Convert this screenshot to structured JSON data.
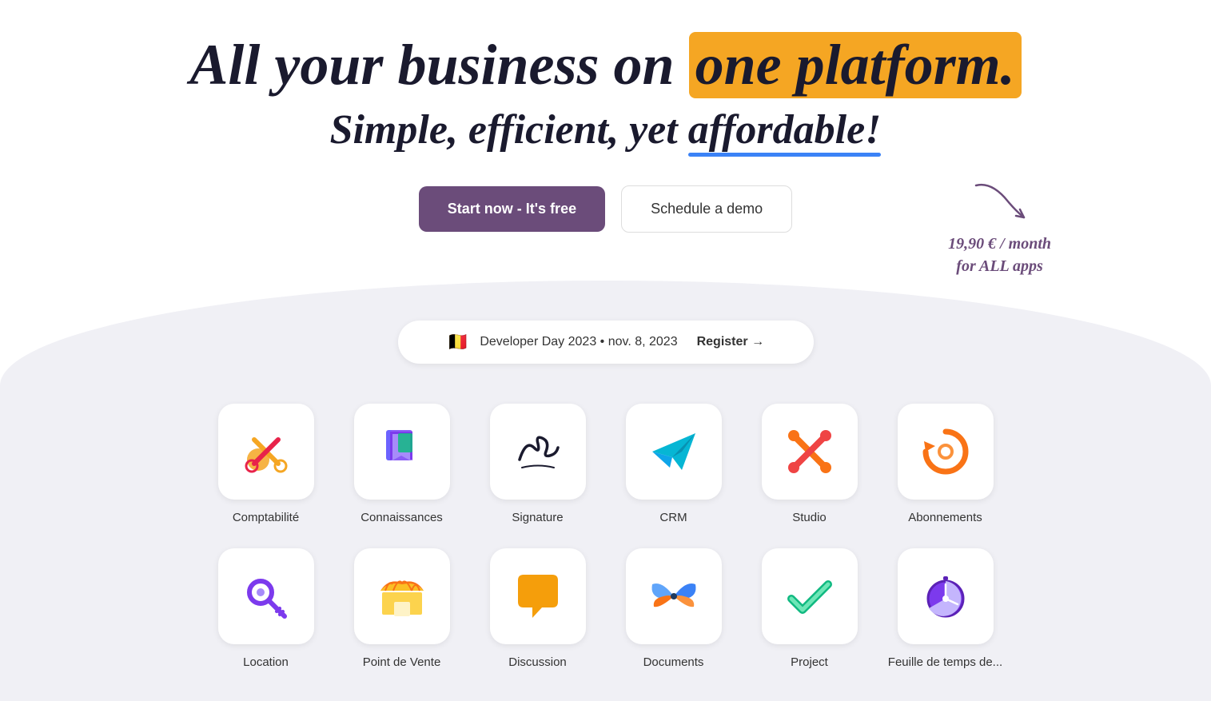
{
  "hero": {
    "title_part1": "All your business on",
    "title_highlight": "one platform.",
    "subtitle_part1": "Simple, efficient, yet",
    "subtitle_highlight": "affordable!",
    "price_annotation": "19,90 € / month\nfor ALL apps"
  },
  "cta": {
    "primary_label": "Start now - It's free",
    "secondary_label": "Schedule a demo"
  },
  "event": {
    "flag": "🇧🇪",
    "text": "Developer Day 2023 • nov. 8, 2023",
    "register": "Register →"
  },
  "apps": [
    {
      "label": "Comptabilité",
      "id": "comptabilite"
    },
    {
      "label": "Connaissances",
      "id": "connaissances"
    },
    {
      "label": "Signature",
      "id": "signature"
    },
    {
      "label": "CRM",
      "id": "crm"
    },
    {
      "label": "Studio",
      "id": "studio"
    },
    {
      "label": "Abonnements",
      "id": "abonnements"
    },
    {
      "label": "Location",
      "id": "location"
    },
    {
      "label": "Point de Vente",
      "id": "point-de-vente"
    },
    {
      "label": "Discussion",
      "id": "discussion"
    },
    {
      "label": "Documents",
      "id": "documents"
    },
    {
      "label": "Project",
      "id": "project"
    },
    {
      "label": "Feuille de temps de...",
      "id": "feuille-de-temps"
    }
  ]
}
